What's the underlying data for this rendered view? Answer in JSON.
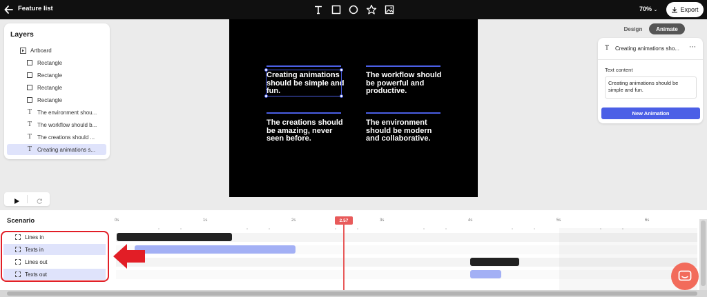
{
  "topbar": {
    "title": "Feature list",
    "zoom": "70%",
    "export_label": "Export",
    "tools": [
      "text-tool-icon",
      "rectangle-tool-icon",
      "ellipse-tool-icon",
      "star-tool-icon",
      "image-tool-icon"
    ]
  },
  "layers": {
    "title": "Layers",
    "items": [
      {
        "label": "Artboard",
        "type": "artboard"
      },
      {
        "label": "Rectangle",
        "type": "rect"
      },
      {
        "label": "Rectangle",
        "type": "rect"
      },
      {
        "label": "Rectangle",
        "type": "rect"
      },
      {
        "label": "Rectangle",
        "type": "rect"
      },
      {
        "label": "The environment shou...",
        "type": "text"
      },
      {
        "label": "The workflow should b...",
        "type": "text"
      },
      {
        "label": "The creations should ...",
        "type": "text"
      },
      {
        "label": "Creating animations s...",
        "type": "text",
        "selected": true
      }
    ]
  },
  "canvas": {
    "cards": [
      "Creating animations should be simple and fun.",
      "The workflow should be powerful and productive.",
      "The creations should be amazing, never seen before.",
      "The environment should be modern and collaborative."
    ],
    "line_color": "#4b5fe6"
  },
  "mode_toggle": {
    "design": "Design",
    "animate": "Animate"
  },
  "right_panel": {
    "title": "Creating animations sho...",
    "text_label": "Text content",
    "text_value": "Creating animations should be simple and fun.",
    "button": "New Animation"
  },
  "timeline": {
    "title": "Scenario",
    "ticks": [
      "0s",
      "1s",
      "2s",
      "3s",
      "4s",
      "5s",
      "6s"
    ],
    "playhead": "2.57",
    "rows": [
      {
        "label": "Lines in",
        "active": false
      },
      {
        "label": "Texts in",
        "active": true
      },
      {
        "label": "Lines out",
        "active": false
      },
      {
        "label": "Texts out",
        "active": true
      }
    ]
  },
  "colors": {
    "accent": "#4b5fe6",
    "playhead": "#e85a5a",
    "annotation": "#e21e26",
    "bar_dark": "#222222",
    "bar_light": "#a3b0f5"
  }
}
